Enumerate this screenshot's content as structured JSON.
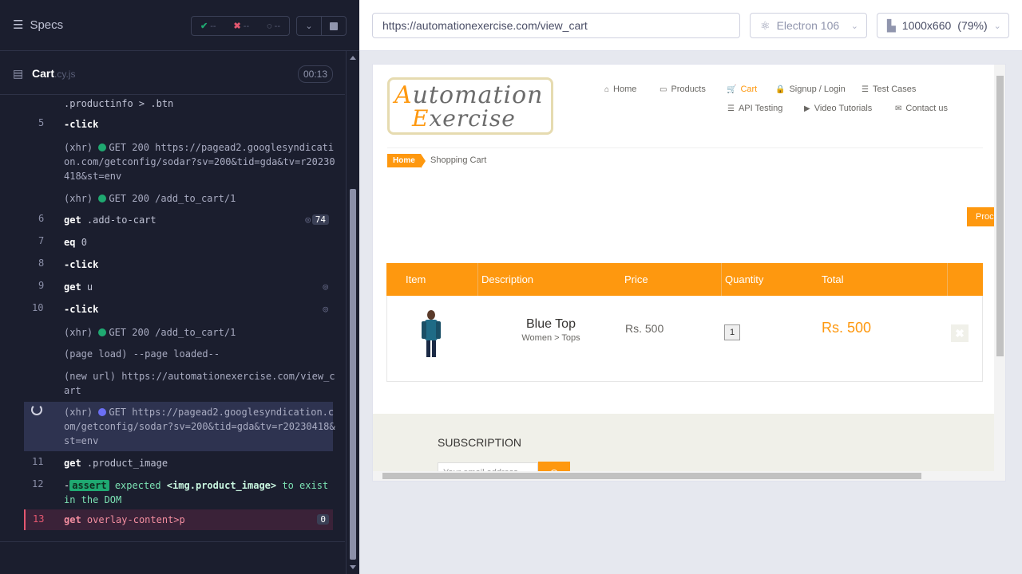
{
  "runner": {
    "specs_label": "Specs",
    "stats": {
      "pass": "--",
      "fail": "--",
      "pending": "--"
    },
    "file": {
      "name": "Cart",
      "ext": ".cy.js",
      "timer": "00:13"
    },
    "log": {
      "l0": ".productinfo > .btn",
      "r5_num": "5",
      "r5_cmd": "-click",
      "r5a_type": "(xhr)",
      "r5a_text": "GET 200 https://pagead2.googlesyndication.com/getconfig/sodar?sv=200&tid=gda&tv=r20230418&st=env",
      "r5b_type": "(xhr)",
      "r5b_text": "GET 200 /add_to_cart/1",
      "r6_num": "6",
      "r6_cmd": "get",
      "r6_arg": ".add-to-cart",
      "r6_count": "74",
      "r7_num": "7",
      "r7_cmd": "eq",
      "r7_arg": "0",
      "r8_num": "8",
      "r8_cmd": "-click",
      "r9_num": "9",
      "r9_cmd": "get",
      "r9_arg": "u",
      "r10_num": "10",
      "r10_cmd": "-click",
      "r10a_type": "(xhr)",
      "r10a_text": "GET 200 /add_to_cart/1",
      "r10b_type": "(page load)",
      "r10b_text": "--page loaded--",
      "r10c_type": "(new url)",
      "r10c_text": "https://automationexercise.com/view_cart",
      "sel_type": "(xhr)",
      "sel_text": "GET https://pagead2.googlesyndication.com/getconfig/sodar?sv=200&tid=gda&tv=r20230418&st=env",
      "r11_num": "11",
      "r11_cmd": "get",
      "r11_arg": ".product_image",
      "r12_num": "12",
      "r12_assert": "assert",
      "r12_pre": "expected",
      "r12_el": "<img.product_image>",
      "r12_post": "to exist in the DOM",
      "r13_num": "13",
      "r13_cmd": "get",
      "r13_arg": "overlay-content>p",
      "r13_count": "0"
    }
  },
  "aut": {
    "url": "https://automationexercise.com/view_cart",
    "browser": "Electron 106",
    "viewport": "1000x660",
    "zoom": "(79%)"
  },
  "site": {
    "logo_line1_first": "A",
    "logo_line1_rest": "utomation",
    "logo_line2_first": "E",
    "logo_line2_rest": "xercise",
    "nav": {
      "home": "Home",
      "products": "Products",
      "cart": "Cart",
      "signup": "Signup / Login",
      "test_cases": "Test Cases",
      "api": "API Testing",
      "video": "Video Tutorials",
      "contact": "Contact us"
    },
    "breadcrumb": {
      "home": "Home",
      "current": "Shopping Cart"
    },
    "proceed": "Proceed To Checkout",
    "table": {
      "headers": [
        "Item",
        "Description",
        "Price",
        "Quantity",
        "Total"
      ],
      "row": {
        "name": "Blue Top",
        "category": "Women > Tops",
        "price": "Rs. 500",
        "quantity": "1",
        "total": "Rs. 500"
      }
    },
    "footer": {
      "subscription": "SUBSCRIPTION",
      "placeholder": "Your email address"
    }
  },
  "colors": {
    "accent": "#fe980f",
    "runner_bg": "#1b1e2e",
    "pass": "#1fa971",
    "fail": "#e45770"
  }
}
